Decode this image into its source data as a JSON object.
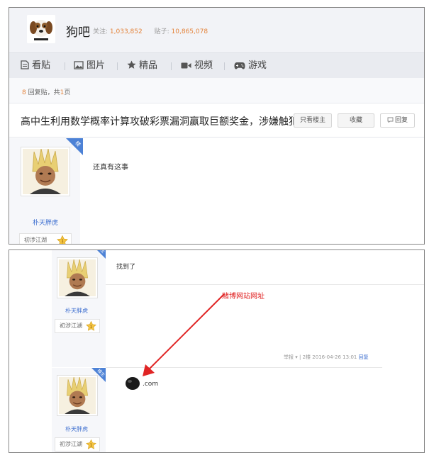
{
  "forum": {
    "name": "狗吧",
    "followers_label": "关注:",
    "followers": "1,033,852",
    "posts_label": "贴子:",
    "posts": "10,865,078"
  },
  "nav": {
    "tabs": [
      {
        "label": "看贴",
        "icon": "doc-icon"
      },
      {
        "label": "图片",
        "icon": "image-icon"
      },
      {
        "label": "精品",
        "icon": "star-icon"
      },
      {
        "label": "视频",
        "icon": "video-icon"
      },
      {
        "label": "游戏",
        "icon": "gamepad-icon"
      }
    ]
  },
  "pager": {
    "count": "8",
    "text_mid": "回复贴，共",
    "pages": "1",
    "text_end": "页"
  },
  "thread": {
    "title": "高中生利用数学概率计算攻破彩票漏洞赢取巨额奖金，涉嫌触犯...",
    "only_op_label": "只看楼主",
    "favorite_label": "收藏",
    "reply_label": "回复"
  },
  "posts": [
    {
      "author": "朴天胖虎",
      "level": "初涉江湖",
      "level_num": "1",
      "badge": "楼主",
      "content": "还真有这事"
    },
    {
      "author": "朴天胖虎",
      "level": "初涉江湖",
      "level_num": "1",
      "badge": "楼主",
      "content": "找到了",
      "meta": {
        "report": "举报 ▾",
        "sep": "|",
        "floor": "2楼",
        "date": "2016-04-26 13:01",
        "reply": "回复"
      }
    },
    {
      "author": "朴天胖虎",
      "level": "初涉江湖",
      "level_num": "1",
      "badge": "楼主",
      "content": ".com"
    }
  ],
  "annotation": {
    "text": "赌博网站网址",
    "color": "#e02424"
  },
  "colors": {
    "accent_orange": "#e4833a",
    "link_blue": "#3a6ccf",
    "badge_blue": "#4d82d6"
  }
}
